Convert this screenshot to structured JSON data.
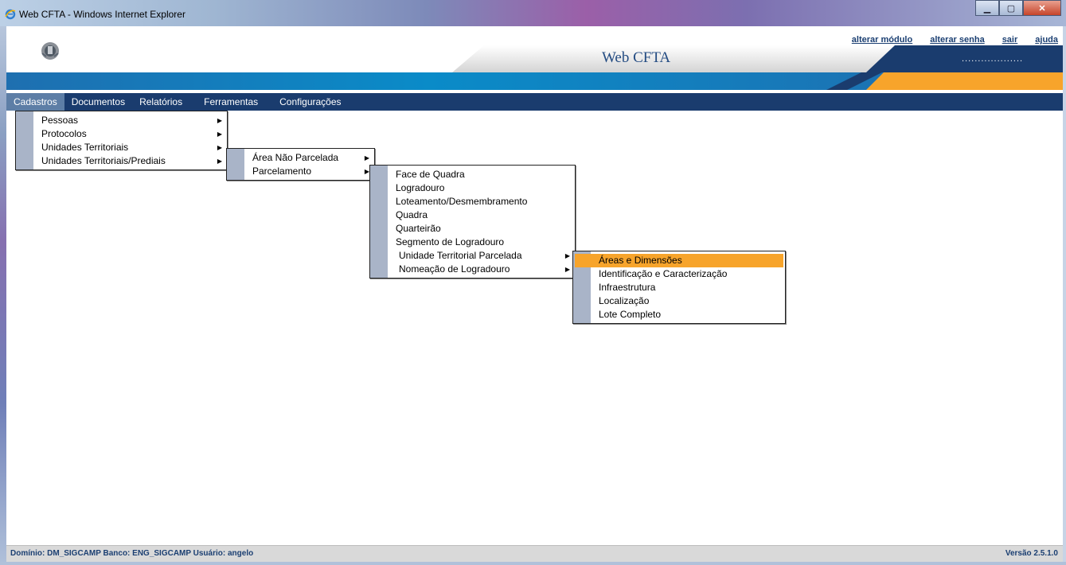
{
  "window": {
    "title": "Web CFTA - Windows Internet Explorer"
  },
  "header": {
    "app_title": "Web CFTA",
    "dots": "...................",
    "links": [
      "alterar módulo",
      "alterar senha",
      "sair",
      "ajuda"
    ]
  },
  "menu": [
    "Cadastros",
    "Documentos",
    "Relatórios",
    "Ferramentas",
    "Configurações"
  ],
  "dropdowns": {
    "cadastros": [
      {
        "label": "Pessoas",
        "submenu": true
      },
      {
        "label": "Protocolos",
        "submenu": true
      },
      {
        "label": "Unidades Territoriais",
        "submenu": true
      },
      {
        "label": "Unidades Territoriais/Prediais",
        "submenu": true
      }
    ],
    "unidades_territoriais": [
      {
        "label": "Área Não Parcelada",
        "submenu": true
      },
      {
        "label": "Parcelamento",
        "submenu": true
      }
    ],
    "parcelamento": [
      {
        "label": "Face de Quadra",
        "submenu": false
      },
      {
        "label": "Logradouro",
        "submenu": false
      },
      {
        "label": "Loteamento/Desmembramento",
        "submenu": false
      },
      {
        "label": "Quadra",
        "submenu": false
      },
      {
        "label": "Quarteirão",
        "submenu": false
      },
      {
        "label": "Segmento de Logradouro",
        "submenu": false
      },
      {
        "label": "Unidade Territorial Parcelada",
        "submenu": true
      },
      {
        "label": "Nomeação de Logradouro",
        "submenu": true
      }
    ],
    "unidade_territorial_parcelada": [
      {
        "label": "Áreas e Dimensões",
        "submenu": false,
        "highlighted": true
      },
      {
        "label": "Identificação e Caracterização",
        "submenu": false
      },
      {
        "label": "Infraestrutura",
        "submenu": false
      },
      {
        "label": "Localização",
        "submenu": false
      },
      {
        "label": "Lote Completo",
        "submenu": false
      }
    ]
  },
  "status": {
    "left": "Domínio: DM_SIGCAMP  Banco: ENG_SIGCAMP  Usuário: angelo",
    "right": "Versão 2.5.1.0"
  },
  "colors": {
    "navy": "#1a3c6e",
    "orange": "#f7a42b",
    "active_menu": "#5d7ea6"
  },
  "icons": {
    "window": "internet-explorer-icon",
    "logo": "municipal-crest-icon",
    "submenu": "triangle-right-icon"
  }
}
